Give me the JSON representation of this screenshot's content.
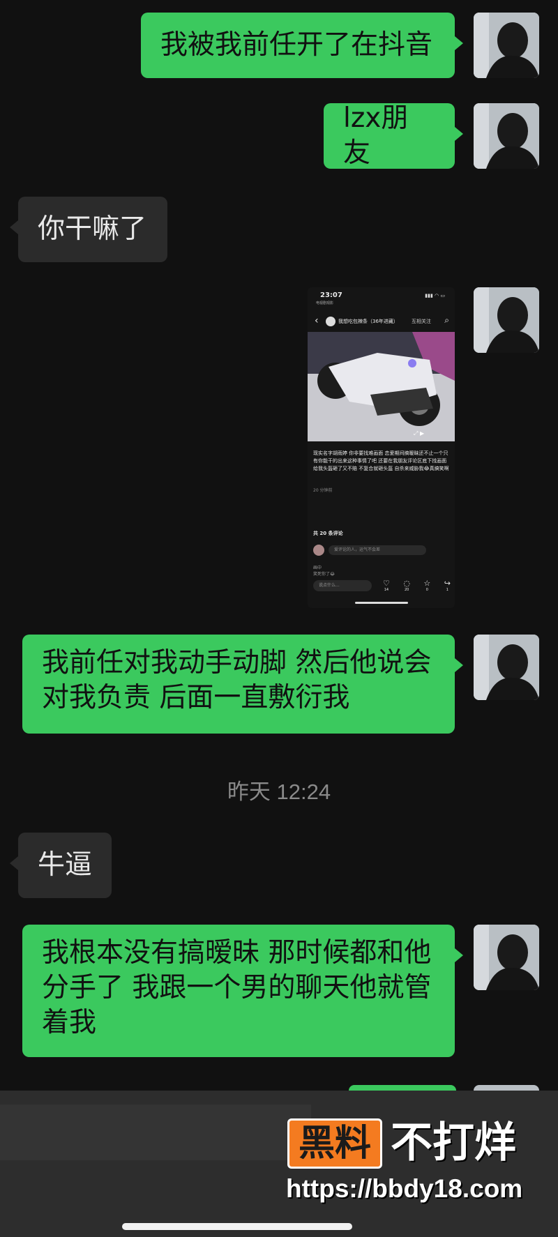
{
  "messages": [
    {
      "dir": "out",
      "text": "我被我前任开了在抖音"
    },
    {
      "dir": "out",
      "text": "lzx朋友"
    },
    {
      "dir": "in",
      "text": "你干嘛了"
    },
    {
      "dir": "out",
      "type": "image",
      "icon": "screenshot-image"
    },
    {
      "dir": "out",
      "lines": [
        "我前任对我动手动脚 然后他说会",
        "对我负责 后面一直敷衍我"
      ]
    },
    {
      "dir": "in",
      "text": "牛逼"
    },
    {
      "dir": "out",
      "lines": [
        "我根本没有搞暧昧 那时候都和他",
        "分手了 我跟一个男的聊天他就管",
        "着我"
      ]
    }
  ],
  "timestamp": "昨天 12:24",
  "screenshot": {
    "time": "23:07",
    "status_sub": "电视剧观影",
    "account": "我想吃包辣条（36年进藏）",
    "follow": "互相关注",
    "caption": "现实名字胡雨婷 你非要找难画面 恋爱期间搞暧昧还不止一个只有你能干的出来这种事情了吧 还要在我朋友评论区底下找画面 给我头盔砸了又不赔 不复合就砸头盔 自杀来威胁我😂真搞笑啊",
    "time_ago": "20 分钟前",
    "comment_count": "共 20 条评论",
    "comment_placeholder": "爱评论的人，运气不会差",
    "comment_user": "画中",
    "comment_text": "笑死你了😂",
    "say_placeholder": "说点什么...",
    "actions": [
      {
        "icon": "heart-icon",
        "count": "14"
      },
      {
        "icon": "comment-icon",
        "count": "20"
      },
      {
        "icon": "star-icon",
        "count": "0"
      },
      {
        "icon": "share-icon",
        "count": "1"
      }
    ]
  },
  "watermark": {
    "badge": "黑料",
    "text": "不打烊",
    "url": "https://bbdy18.com"
  },
  "colors": {
    "background": "#111111",
    "outgoing_bubble": "#3bc95e",
    "incoming_bubble": "#2b2b2b",
    "watermark_orange": "#f47b20"
  }
}
